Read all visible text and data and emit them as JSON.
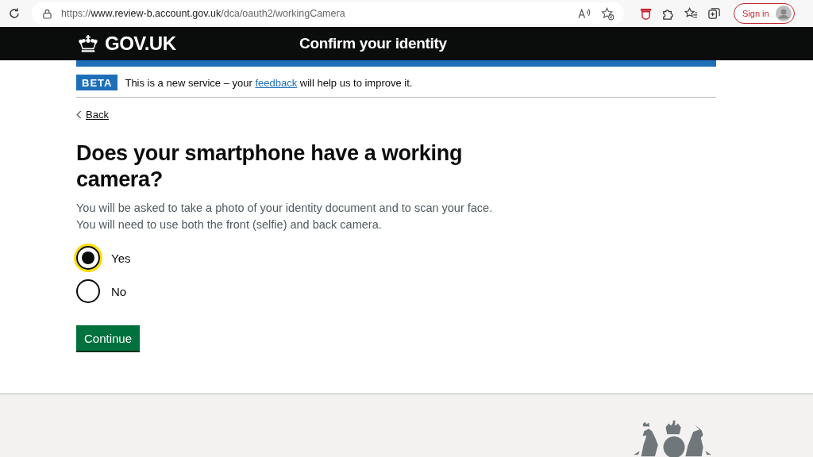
{
  "browser": {
    "url_scheme": "https://",
    "url_host": "www.review-b.account.gov.uk",
    "url_path": "/dca/oauth2/workingCamera",
    "sign_in": "Sign in"
  },
  "header": {
    "logo": "GOV.UK",
    "service": "Confirm your identity"
  },
  "phase_banner": {
    "tag": "BETA",
    "text_before": "This is a new service – your ",
    "link": "feedback",
    "text_after": " will help us to improve it."
  },
  "back_link": "Back",
  "question": {
    "heading": "Does your smartphone have a working camera?",
    "hint": "You will be asked to take a photo of your identity document and to scan your face. You will need to use both the front (selfie) and back camera."
  },
  "options": [
    {
      "label": "Yes",
      "selected": true,
      "focused": true
    },
    {
      "label": "No",
      "selected": false,
      "focused": false
    }
  ],
  "button": "Continue"
}
